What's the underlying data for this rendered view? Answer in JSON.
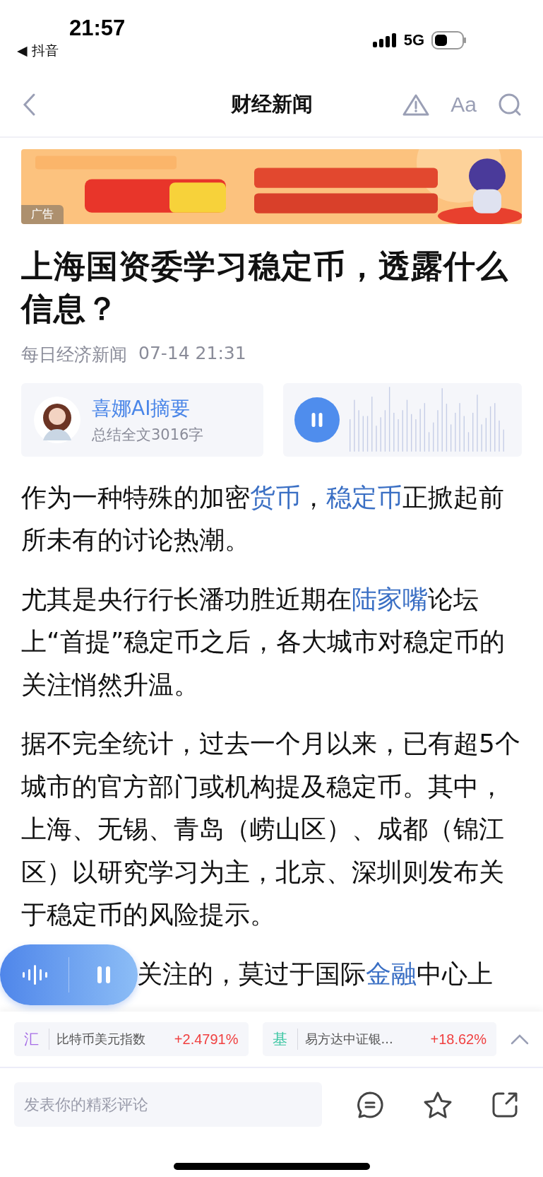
{
  "status_bar": {
    "time": "21:57",
    "back_app": {
      "arrow": "◀",
      "label": "抖音"
    },
    "network": "5G"
  },
  "header": {
    "title": "财经新闻",
    "font_button": "Aa"
  },
  "ad": {
    "kind": "picture",
    "label": "广告"
  },
  "article": {
    "headline": "上海国资委学习稳定币，透露什么信息？",
    "source": "每日经济新闻",
    "time": "07-14 21:31",
    "summary": {
      "title": "喜娜AI摘要",
      "subtitle": "总结全文3016字"
    },
    "audio": {
      "playing": true
    },
    "paragraphs": [
      [
        {
          "text": "作为一种特殊的加密",
          "link": false
        },
        {
          "text": "货币",
          "link": true
        },
        {
          "text": "，",
          "link": false
        },
        {
          "text": "稳定币",
          "link": true
        },
        {
          "text": "正掀起前所未有的讨论热潮。",
          "link": false
        }
      ],
      [
        {
          "text": "尤其是央行行长潘功胜近期在",
          "link": false
        },
        {
          "text": "陆家嘴",
          "link": true
        },
        {
          "text": "论坛上“首提”稳定币之后，各大城市对稳定币的关注悄然升温。",
          "link": false
        }
      ],
      [
        {
          "text": "据不完全统计，过去一个月以来，已有超5个城市的官方部门或机构提及稳定币。其中，上海、无锡、青岛（崂山区）、成都（锦江区）以研究学习为主，北京、深圳则发布关于稳定币的风险提示。",
          "link": false
        }
      ]
    ],
    "partial_line": [
      {
        "text": "关注的，莫过于国际",
        "link": false
      },
      {
        "text": "金融",
        "link": true
      },
      {
        "text": "中心上",
        "link": false
      }
    ]
  },
  "player": {
    "playing": true
  },
  "tickers": [
    {
      "tag": "汇",
      "color": "#a76ee6",
      "name": "比特币美元指数",
      "change": "+2.4791%"
    },
    {
      "tag": "基",
      "color": "#3cc7a3",
      "name": "易方达中证银...",
      "change": "+18.62%"
    }
  ],
  "comment": {
    "placeholder": "发表你的精彩评论"
  }
}
